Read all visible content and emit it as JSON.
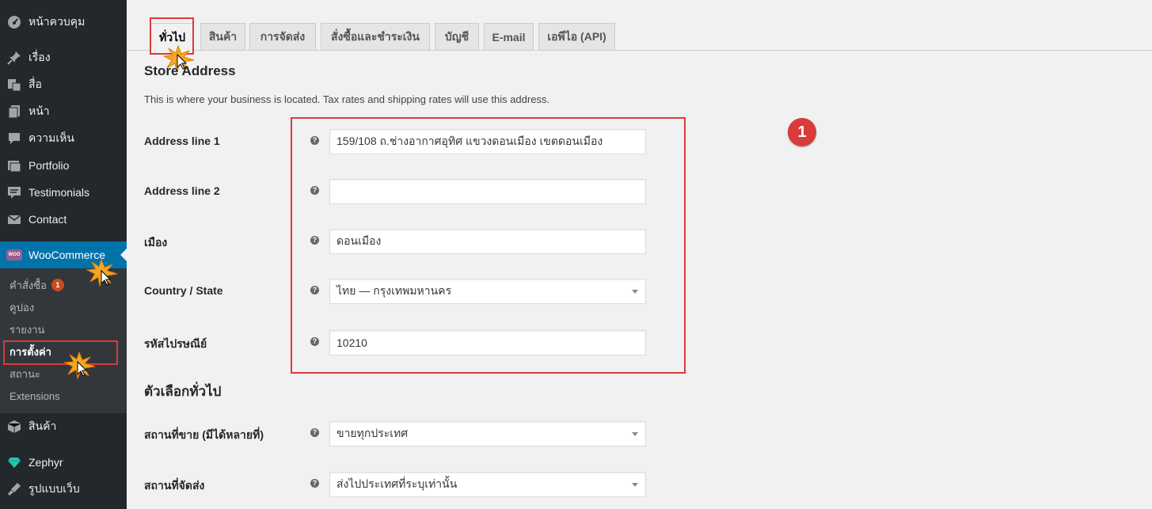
{
  "sidebar": {
    "items": [
      {
        "label": "หน้าควบคุม",
        "icon": "dashboard-icon"
      },
      {
        "label": "เรื่อง",
        "icon": "pin-icon"
      },
      {
        "label": "สื่อ",
        "icon": "media-icon"
      },
      {
        "label": "หน้า",
        "icon": "page-icon"
      },
      {
        "label": "ความเห็น",
        "icon": "comment-icon"
      },
      {
        "label": "Portfolio",
        "icon": "portfolio-icon"
      },
      {
        "label": "Testimonials",
        "icon": "testimonial-icon"
      },
      {
        "label": "Contact",
        "icon": "mail-icon"
      },
      {
        "label": "WooCommerce",
        "icon": "woocommerce-icon"
      },
      {
        "label": "สินค้า",
        "icon": "box-icon"
      },
      {
        "label": "Zephyr",
        "icon": "diamond-icon"
      },
      {
        "label": "รูปแบบเว็บ",
        "icon": "brush-icon"
      }
    ],
    "woo_logo_text": "WOO",
    "submenu": [
      {
        "label": "คำสั่งซื้อ",
        "badge": "1"
      },
      {
        "label": "คูปอง"
      },
      {
        "label": "รายงาน"
      },
      {
        "label": "การตั้งค่า"
      },
      {
        "label": "สถานะ"
      },
      {
        "label": "Extensions"
      }
    ]
  },
  "tabs": [
    "ทั่วไป",
    "สินค้า",
    "การจัดส่ง",
    "สั่งซื้อและชำระเงิน",
    "บัญชี",
    "E-mail",
    "เอพีไอ (API)"
  ],
  "store_address": {
    "title": "Store Address",
    "description": "This is where your business is located. Tax rates and shipping rates will use this address.",
    "fields": [
      {
        "label": "Address line 1",
        "value": "159/108 ถ.ช่างอากาศอุทิศ แขวงดอนเมือง เขตดอนเมือง"
      },
      {
        "label": "Address line 2",
        "value": ""
      },
      {
        "label": "เมือง",
        "value": "ดอนเมือง"
      },
      {
        "label": "Country / State",
        "value": "ไทย — กรุงเทพมหานคร"
      },
      {
        "label": "รหัสไปรษณีย์",
        "value": "10210"
      }
    ]
  },
  "general_options": {
    "title": "ตัวเลือกทั่วไป",
    "fields": [
      {
        "label": "สถานที่ขาย (มีได้หลายที่)",
        "value": "ขายทุกประเทศ"
      },
      {
        "label": "สถานที่จัดส่ง",
        "value": "ส่งไปประเทศที่ระบุเท่านั้น"
      }
    ]
  },
  "help_glyph": "?",
  "annotation_number": "1",
  "colors": {
    "sidebar": "#23282d",
    "active": "#0073aa",
    "highlight": "#dd3a3a"
  }
}
